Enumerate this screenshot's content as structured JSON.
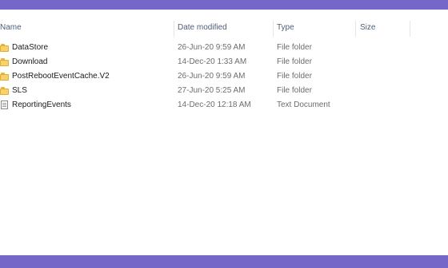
{
  "columns": {
    "name": "Name",
    "date_modified": "Date modified",
    "type": "Type",
    "size": "Size"
  },
  "files": [
    {
      "name": "DataStore",
      "date_modified": "26-Jun-20 9:59 AM",
      "type": "File folder",
      "size": "",
      "icon": "folder-icon"
    },
    {
      "name": "Download",
      "date_modified": "14-Dec-20 1:33 AM",
      "type": "File folder",
      "size": "",
      "icon": "folder-icon"
    },
    {
      "name": "PostRebootEventCache.V2",
      "date_modified": "26-Jun-20 9:59 AM",
      "type": "File folder",
      "size": "",
      "icon": "folder-icon"
    },
    {
      "name": "SLS",
      "date_modified": "27-Jun-20 5:25 AM",
      "type": "File folder",
      "size": "",
      "icon": "folder-icon"
    },
    {
      "name": "ReportingEvents",
      "date_modified": "14-Dec-20 12:18 AM",
      "type": "Text Document",
      "size": "",
      "icon": "text-document-icon"
    }
  ],
  "colors": {
    "accent_bar": "#7467c8",
    "folder_yellow": "#f8d16a"
  }
}
